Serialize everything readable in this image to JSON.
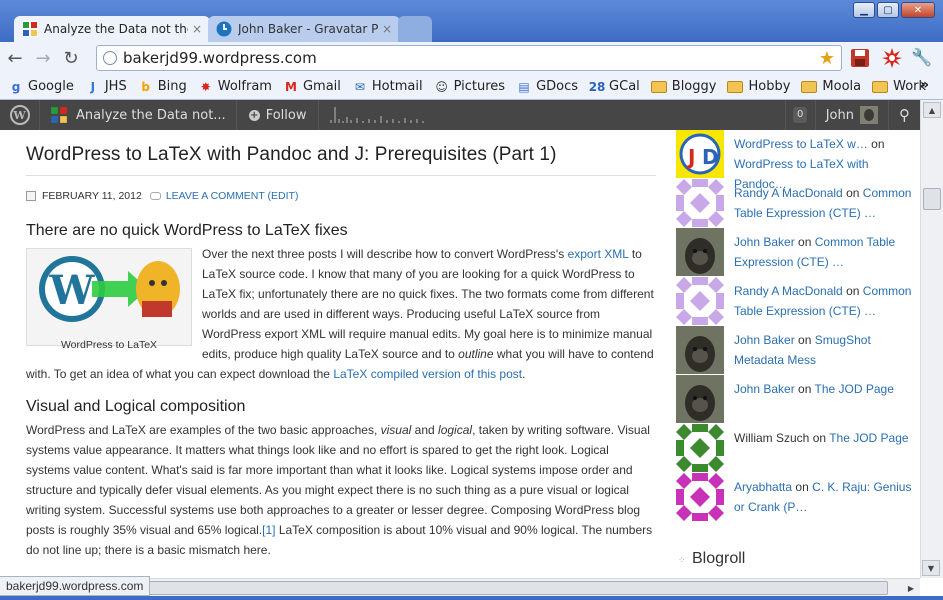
{
  "window": {
    "tabs": [
      {
        "title": "Analyze the Data not the I",
        "active": true
      },
      {
        "title": "John Baker - Gravatar Pro",
        "active": false
      }
    ],
    "close_glyph": "×",
    "controls": {
      "minimize": "▁",
      "maximize": "▢",
      "close": "✕"
    }
  },
  "toolbar": {
    "back": "←",
    "forward": "→",
    "reload": "↻",
    "url": "bakerjd99.wordpress.com",
    "star": "★",
    "extensions": [
      "save-icon",
      "gear-burst-icon",
      "wrench-icon"
    ],
    "wrench_glyph": "🔧"
  },
  "bookmarks": [
    {
      "label": "Google",
      "icon": "google-icon",
      "glyph": "g",
      "color": "#3d6fd6"
    },
    {
      "label": "JHS",
      "icon": "j-icon",
      "glyph": "J",
      "color": "#2f7bd8"
    },
    {
      "label": "Bing",
      "icon": "bing-icon",
      "glyph": "b",
      "color": "#f4a100"
    },
    {
      "label": "Wolfram",
      "icon": "wolfram-icon",
      "glyph": "✸",
      "color": "#d6281e"
    },
    {
      "label": "Gmail",
      "icon": "gmail-icon",
      "glyph": "M",
      "color": "#d6281e"
    },
    {
      "label": "Hotmail",
      "icon": "hotmail-icon",
      "glyph": "✉",
      "color": "#2a64b8"
    },
    {
      "label": "Pictures",
      "icon": "pictures-icon",
      "glyph": "☺",
      "color": "#333333"
    },
    {
      "label": "GDocs",
      "icon": "gdocs-icon",
      "glyph": "▤",
      "color": "#3d6fd6"
    },
    {
      "label": "GCal",
      "icon": "gcal-icon",
      "glyph": "28",
      "color": "#2a64b8"
    },
    {
      "label": "Bloggy",
      "icon": "folder-icon"
    },
    {
      "label": "Hobby",
      "icon": "folder-icon"
    },
    {
      "label": "Moola",
      "icon": "folder-icon"
    },
    {
      "label": "Work",
      "icon": "folder-icon"
    }
  ],
  "bookmarks_more": "»",
  "wpbar": {
    "logo": "W",
    "site": "Analyze the Data not...",
    "follow": "Follow",
    "notifications": "0",
    "user": "John",
    "search_glyph": "⚲"
  },
  "post": {
    "title": "WordPress to LaTeX with Pandoc and J: Prerequisites (Part 1)",
    "date": "FEBRUARY 11, 2012",
    "comment_link": "LEAVE A COMMENT (EDIT)",
    "section1_heading": "There are no quick WordPress to LaTeX fixes",
    "figure_caption": "WordPress to LaTeX",
    "p1": {
      "t1": "Over the next three posts I will describe how to convert WordPress's ",
      "link1": "export XML",
      "t2": " to LaTeX source code.  I know that many of you are looking for a quick WordPress to LaTeX fix; unfortunately there are no quick fixes. The two formats come from different worlds and are used in different ways.  Producing useful LaTeX source from WordPress export XML will require manual edits.  My goal here is to minimize manual edits, produce high quality LaTeX source and to ",
      "em1": "outline",
      "t3": " what you will have to contend with. To get an idea of what you can expect download the ",
      "link2": "LaTeX compiled version of this post",
      "t4": "."
    },
    "section2_heading": "Visual and Logical composition",
    "p2": {
      "t1": "WordPress and LaTeX are examples of the two basic approaches, ",
      "em1": "visual",
      "t2": " and ",
      "em2": "logical",
      "t3": ", taken by writing software. Visual systems value appearance. It matters what things look like and no effort is spared to get the right look. Logical systems value content. What's said is far more important than what it looks like. Logical systems impose order and structure and typically defer visual elements.  As you might expect there is no such thing as a pure visual or logical writing system. Successful systems use both approaches to a greater or lesser degree. Composing WordPress blog posts is roughly 35% visual and 65% logical.",
      "footnote": "[1]",
      "t4": "  LaTeX composition is about 10% visual and 90% logical. The numbers do not line up; there is a basic mismatch here."
    }
  },
  "sidebar": {
    "comments": [
      {
        "author": "WordPress to LaTeX w…",
        "author_is_link": true,
        "on": "on",
        "post": "WordPress to LaTeX with Pandoc…",
        "avatar": "jod-avatar"
      },
      {
        "author": "Randy A MacDonald",
        "author_is_link": true,
        "on": "on",
        "post": "Common Table Expression (CTE) …",
        "avatar": "identicon-lavender"
      },
      {
        "author": "John Baker",
        "author_is_link": true,
        "on": "on",
        "post": "Common Table Expression (CTE) …",
        "avatar": "gorilla-avatar"
      },
      {
        "author": "Randy A MacDonald",
        "author_is_link": true,
        "on": "on",
        "post": "Common Table Expression (CTE) …",
        "avatar": "identicon-lavender"
      },
      {
        "author": "John Baker",
        "author_is_link": true,
        "on": "on",
        "post": "SmugShot Metadata Mess",
        "avatar": "gorilla-avatar"
      },
      {
        "author": "John Baker",
        "author_is_link": true,
        "on": "on",
        "post": "The JOD Page",
        "avatar": "gorilla-avatar"
      },
      {
        "author": "William Szuch",
        "author_is_link": false,
        "on": "on",
        "post": "The JOD Page",
        "avatar": "identicon-green"
      },
      {
        "author": "Aryabhatta",
        "author_is_link": true,
        "on": "on",
        "post": "C. K. Raju: Genius or Crank (P…",
        "avatar": "identicon-magenta"
      }
    ],
    "blogroll": "Blogroll"
  },
  "status_url": "bakerjd99.wordpress.com",
  "colors": {
    "link": "#2a6fb0",
    "wpbar": "#464646",
    "chrome_frame": "#3d6cc4"
  }
}
